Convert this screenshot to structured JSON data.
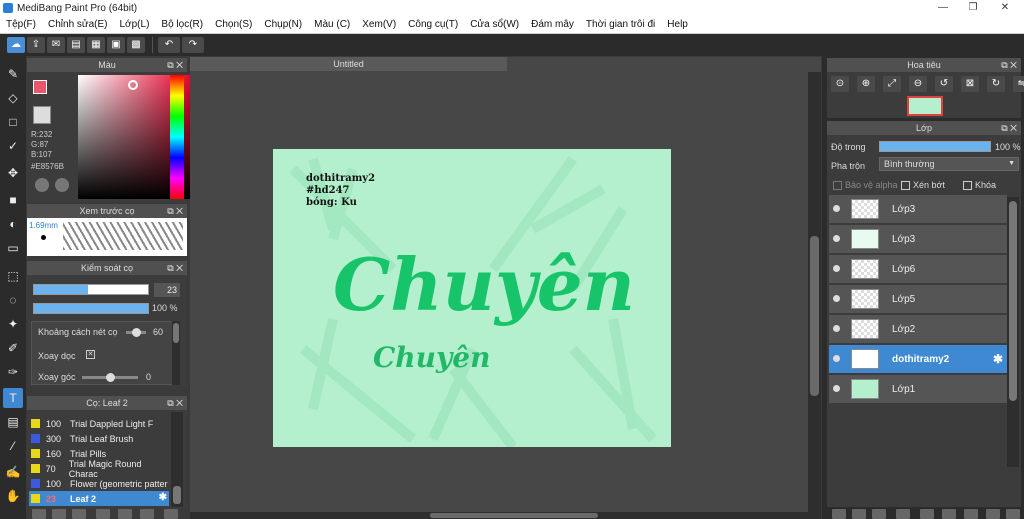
{
  "window": {
    "title": "MediBang Paint Pro (64bit)",
    "min": "—",
    "max": "❐",
    "close": "✕"
  },
  "menu": [
    "Tệp(F)",
    "Chỉnh sửa(E)",
    "Lớp(L)",
    "Bộ lọc(R)",
    "Chọn(S)",
    "Chụp(N)",
    "Màu (C)",
    "Xem(V)",
    "Công cụ(T)",
    "Cửa sổ(W)",
    "Đám mây",
    "Thời gian trôi đi",
    "Help"
  ],
  "toolbar_icons": [
    "cloud-icon",
    "share-icon",
    "comment-icon",
    "document-icon",
    "page-icon",
    "panel-icon",
    "grid-icon",
    "undo-icon",
    "redo-icon"
  ],
  "color_panel": {
    "title": "Màu",
    "r": "R:232",
    "g": "G:87",
    "b": "B:107",
    "hex": "#E8576B",
    "primary": "#E8576B"
  },
  "brush_preview": {
    "title": "Xem trước cọ",
    "size": "1.69mm"
  },
  "brush_control": {
    "title": "Kiểm soát cọ",
    "size_value": "23",
    "opacity_value": "100 %",
    "spacing_label": "Khoảng cách nét cọ",
    "spacing_value": "60",
    "rotate_label": "Xoay dọc",
    "angle_label": "Xoay góc",
    "angle_value": "0"
  },
  "brush_list": {
    "title": "Cọ: Leaf 2",
    "items": [
      {
        "size": "100",
        "name": "Trial Dappled Light F",
        "color": "#e8d81c"
      },
      {
        "size": "300",
        "name": "Trial Leaf Brush",
        "color": "#3c5adc"
      },
      {
        "size": "160",
        "name": "Trial Pills",
        "color": "#e8d81c"
      },
      {
        "size": "70",
        "name": "Trial Magic Round Charac",
        "color": "#e8d81c"
      },
      {
        "size": "100",
        "name": "Flower (geometric patter",
        "color": "#3c5adc"
      },
      {
        "size": "23",
        "name": "Leaf 2",
        "color": "#e8d81c"
      }
    ]
  },
  "document": {
    "tab": "Untitled"
  },
  "artwork": {
    "caption_line1": "dothitramy2",
    "caption_line2": "#hd247",
    "caption_line3": "bóng: Ku",
    "big_word": "Chuyên",
    "small_word": "Chuyên"
  },
  "navigator": {
    "title": "Hoa tiêu"
  },
  "layer_panel": {
    "title": "Lớp",
    "opacity_label": "Độ trong",
    "opacity_value": "100 %",
    "blend_label": "Pha trộn",
    "blend_value": "Bình thường",
    "protect_alpha": "Bảo vệ alpha",
    "clip": "Xén bớt",
    "lock": "Khóa",
    "layers": [
      {
        "name": "Lớp3"
      },
      {
        "name": "Lớp3"
      },
      {
        "name": "Lớp6"
      },
      {
        "name": "Lớp5"
      },
      {
        "name": "Lớp2"
      },
      {
        "name": "dothitramy2"
      },
      {
        "name": "Lớp1"
      }
    ]
  }
}
